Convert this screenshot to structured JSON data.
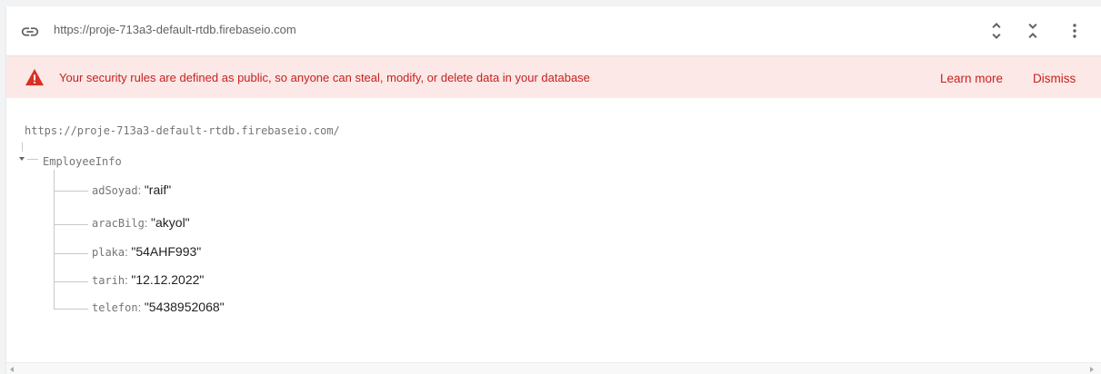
{
  "urlbar": {
    "url": "https://proje-713a3-default-rtdb.firebaseio.com",
    "link_icon": "link-icon",
    "expand_icon": "expand-all-icon",
    "collapse_icon": "collapse-all-icon",
    "more_icon": "more-vert-icon"
  },
  "banner": {
    "icon": "warning-icon",
    "message": "Your security rules are defined as public, so anyone can steal, modify, or delete data in your database",
    "learn_more": "Learn more",
    "dismiss": "Dismiss",
    "color": "#c5221f",
    "background": "#fce8e6"
  },
  "tree": {
    "root_url": "https://proje-713a3-default-rtdb.firebaseio.com/",
    "node": {
      "key": "EmployeeInfo",
      "expanded": true,
      "children": [
        {
          "key": "adSoyad",
          "value": "\"raif\""
        },
        {
          "key": "aracBilg",
          "value": "\"akyol\""
        },
        {
          "key": "plaka",
          "value": "\"54AHF993\""
        },
        {
          "key": "tarih",
          "value": "\"12.12.2022\""
        },
        {
          "key": "telefon",
          "value": "\"5438952068\""
        }
      ]
    }
  }
}
